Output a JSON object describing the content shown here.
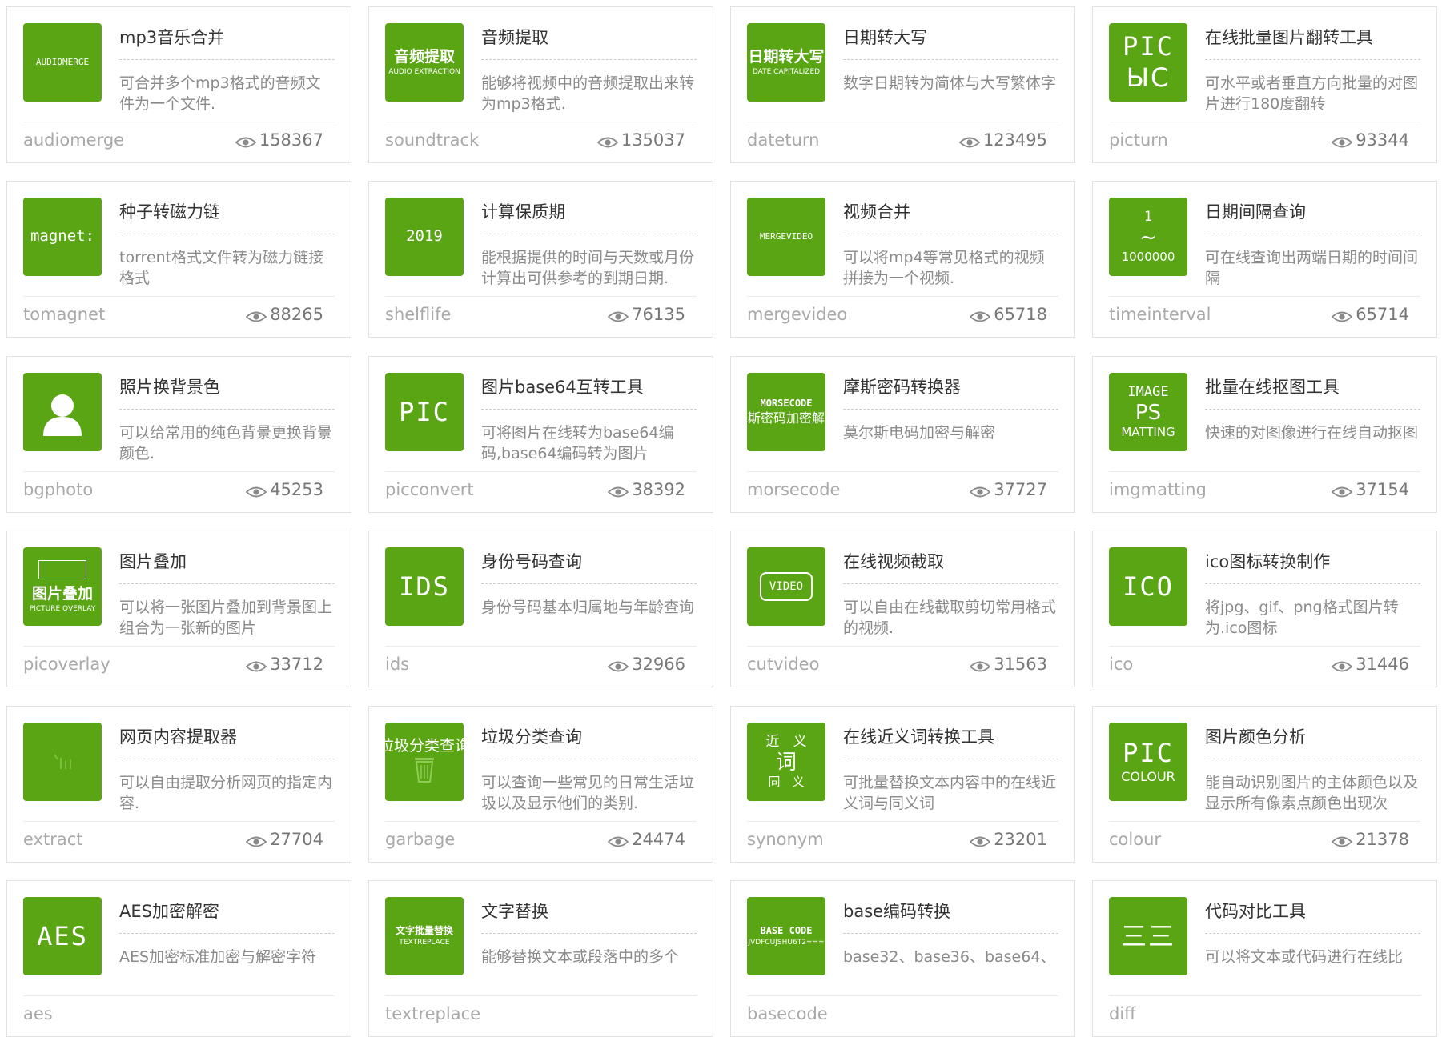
{
  "colors": {
    "accent": "#5aa514",
    "border": "#e2e2e2"
  },
  "tools": [
    {
      "title": "mp3音乐合并",
      "desc": "可合并多个mp3格式的音频文件为一个文件.",
      "slug": "audiomerge",
      "views": "158367",
      "icon": {
        "name": "audiomerge-icon",
        "lines": [
          "AUDIOMERGE"
        ]
      }
    },
    {
      "title": "音频提取",
      "desc": "能够将视频中的音频提取出来转为mp3格式.",
      "slug": "soundtrack",
      "views": "135037",
      "icon": {
        "name": "audio-extraction-icon",
        "lines": [
          "音频提取",
          "AUDIO EXTRACTION"
        ]
      }
    },
    {
      "title": "日期转大写",
      "desc": "数字日期转为简体与大写繁体字",
      "slug": "dateturn",
      "views": "123495",
      "icon": {
        "name": "date-capitalized-icon",
        "lines": [
          "日期转大写",
          "DATE CAPITALIZED"
        ]
      }
    },
    {
      "title": "在线批量图片翻转工具",
      "desc": "可水平或者垂直方向批量的对图片进行180度翻转",
      "slug": "picturn",
      "views": "93344",
      "icon": {
        "name": "pic-flip-icon",
        "lines": [
          "PIC",
          "ЫC"
        ]
      }
    },
    {
      "title": "种子转磁力链",
      "desc": "torrent格式文件转为磁力链接格式",
      "slug": "tomagnet",
      "views": "88265",
      "icon": {
        "name": "magnet-icon",
        "lines": [
          "magnet:"
        ]
      }
    },
    {
      "title": "计算保质期",
      "desc": "能根据提供的时间与天数或月份计算出可供参考的到期日期.",
      "slug": "shelflife",
      "views": "76135",
      "icon": {
        "name": "shelflife-icon",
        "lines": [
          "2019"
        ]
      }
    },
    {
      "title": "视频合并",
      "desc": "可以将mp4等常见格式的视频拼接为一个视频.",
      "slug": "mergevideo",
      "views": "65718",
      "icon": {
        "name": "mergevideo-icon",
        "lines": [
          "MERGEVIDEO"
        ]
      }
    },
    {
      "title": "日期间隔查询",
      "desc": "可在线查询出两端日期的时间间隔",
      "slug": "timeinterval",
      "views": "65714",
      "icon": {
        "name": "time-interval-icon",
        "lines": [
          "1",
          "~",
          "1000000"
        ]
      }
    },
    {
      "title": "照片换背景色",
      "desc": "可以给常用的纯色背景更换背景颜色.",
      "slug": "bgphoto",
      "views": "45253",
      "icon": {
        "name": "person-silhouette-icon",
        "lines": []
      }
    },
    {
      "title": "图片base64互转工具",
      "desc": "可将图片在线转为base64编码,base64编码转为图片",
      "slug": "picconvert",
      "views": "38392",
      "icon": {
        "name": "pic-base64-icon",
        "lines": [
          "PIC"
        ]
      }
    },
    {
      "title": "摩斯密码转换器",
      "desc": "莫尔斯电码加密与解密",
      "slug": "morsecode",
      "views": "37727",
      "icon": {
        "name": "morsecode-icon",
        "lines": [
          "MORSECODE",
          "摩斯密码加密解密"
        ]
      }
    },
    {
      "title": "批量在线抠图工具",
      "desc": "快速的对图像进行在线自动抠图",
      "slug": "imgmatting",
      "views": "37154",
      "icon": {
        "name": "image-matting-icon",
        "lines": [
          "IMAGE",
          "PS",
          "MATTING"
        ]
      }
    },
    {
      "title": "图片叠加",
      "desc": "可以将一张图片叠加到背景图上组合为一张新的图片",
      "slug": "picoverlay",
      "views": "33712",
      "icon": {
        "name": "picture-overlay-icon",
        "lines": [
          "图片叠加",
          "PICTURE OVERLAY"
        ]
      }
    },
    {
      "title": "身份号码查询",
      "desc": "身份号码基本归属地与年龄查询",
      "slug": "ids",
      "views": "32966",
      "icon": {
        "name": "ids-icon",
        "lines": [
          "IDS"
        ]
      }
    },
    {
      "title": "在线视频截取",
      "desc": "可以自由在线截取剪切常用格式的视频.",
      "slug": "cutvideo",
      "views": "31563",
      "icon": {
        "name": "video-icon",
        "lines": [
          "VIDEO"
        ]
      }
    },
    {
      "title": "ico图标转换制作",
      "desc": "将jpg、gif、png格式图片转为.ico图标",
      "slug": "ico",
      "views": "31446",
      "icon": {
        "name": "ico-icon",
        "lines": [
          "ICO"
        ]
      }
    },
    {
      "title": "网页内容提取器",
      "desc": "可以自由提取分析网页的指定内容.",
      "slug": "extract",
      "views": "27704",
      "icon": {
        "name": "extract-icon",
        "lines": []
      }
    },
    {
      "title": "垃圾分类查询",
      "desc": "可以查询一些常见的日常生活垃圾以及显示他们的类别.",
      "slug": "garbage",
      "views": "24474",
      "icon": {
        "name": "trash-icon",
        "lines": [
          "垃圾分类查询"
        ]
      }
    },
    {
      "title": "在线近义词转换工具",
      "desc": "可批量替换文本内容中的在线近义词与同义词",
      "slug": "synonym",
      "views": "23201",
      "icon": {
        "name": "synonym-icon",
        "lines": [
          "近　义",
          "词",
          "同　义"
        ]
      }
    },
    {
      "title": "图片颜色分析",
      "desc": "能自动识别图片的主体颜色以及显示所有像素点颜色出现次",
      "slug": "colour",
      "views": "21378",
      "icon": {
        "name": "pic-colour-icon",
        "lines": [
          "PIC",
          "COLOUR"
        ]
      }
    },
    {
      "title": "AES加密解密",
      "desc": "AES加密标准加密与解密字符",
      "slug": "aes",
      "views": "",
      "icon": {
        "name": "aes-icon",
        "lines": [
          "AES"
        ]
      }
    },
    {
      "title": "文字替换",
      "desc": "能够替换文本或段落中的多个",
      "slug": "textreplace",
      "views": "",
      "icon": {
        "name": "text-replace-icon",
        "lines": [
          "文字批量替换",
          "TEXTREPLACE"
        ]
      }
    },
    {
      "title": "base编码转换",
      "desc": "base32、base36、base64、",
      "slug": "basecode",
      "views": "",
      "icon": {
        "name": "base-code-icon",
        "lines": [
          "BASE CODE",
          "JVDFCUJSHU6T2==="
        ]
      }
    },
    {
      "title": "代码对比工具",
      "desc": "可以将文本或代码进行在线比",
      "slug": "diff",
      "views": "",
      "icon": {
        "name": "code-compare-icon",
        "lines": [
          "三三"
        ]
      }
    }
  ]
}
